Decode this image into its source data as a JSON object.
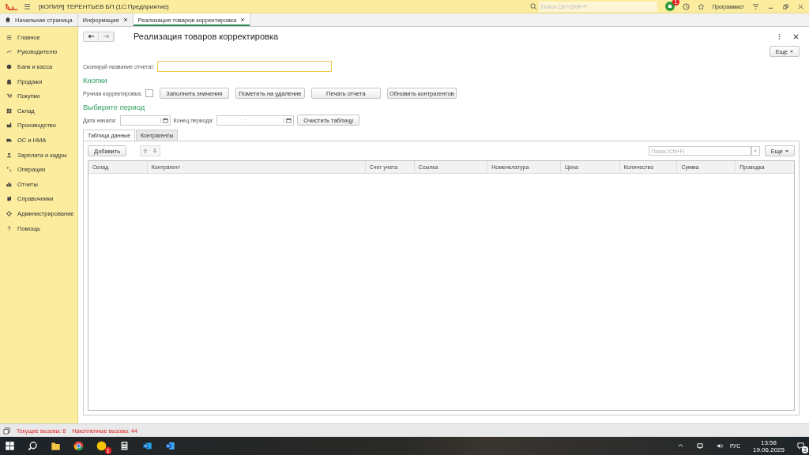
{
  "app": {
    "title": "[КОПИЯ] ТЕРЕНТЬЕВ БП  (1С:Предприятие)",
    "search_placeholder": "Поиск Ctrl+Shift+F",
    "notifications": "1",
    "user": "Программист"
  },
  "tabs": [
    {
      "kind": "home",
      "label": "Начальная страница",
      "selected": false
    },
    {
      "kind": "doc",
      "label": "Информация",
      "selected": false
    },
    {
      "kind": "doc",
      "label": "Реализация товаров корректировка",
      "selected": true
    }
  ],
  "sidebar": {
    "items": [
      "Главное",
      "Руководителю",
      "Банк и касса",
      "Продажи",
      "Покупки",
      "Склад",
      "Производство",
      "ОС и НМА",
      "Зарплата и кадры",
      "Операции",
      "Отчеты",
      "Справочники",
      "Администрирование",
      "Помощь"
    ]
  },
  "form": {
    "title": "Реализация товаров корректировка",
    "more": "Еще",
    "report_name": {
      "label": "Скопируй название отчета!:"
    },
    "buttons_heading": "Кнопки",
    "manual": {
      "label": "Ручная корректировка:",
      "checked": false
    },
    "buttons": [
      "Заполнить значения",
      "Пометить на удаление",
      "Печать отчета",
      "Обновить контрагентов"
    ],
    "period_heading": "Выбирите период",
    "start": {
      "label": "Дата начала:",
      "placeholder": " .  ."
    },
    "end": {
      "label": "Конец периода:",
      "placeholder": " .  .        :  :"
    },
    "clear": "Очистить таблицу",
    "inner_tabs": [
      {
        "label": "Таблица данные",
        "selected": true
      },
      {
        "label": "Контрагенты",
        "selected": false
      }
    ],
    "add": "Добавить",
    "search_placeholder": "Поиск (Ctrl+F)",
    "table_more": "Еще",
    "columns": [
      "Склад",
      "Контрагент",
      "Счет учета",
      "Ссылка",
      "Номенклатура",
      "Цена",
      "Количество",
      "Сумма",
      "Проводка"
    ]
  },
  "status_bar": {
    "current": "Текущие вызовы: 8",
    "accumulated": "Накопленные вызовы: 44"
  },
  "taskbar": {
    "app_badge": "1",
    "language": "РУС",
    "time": "13:58",
    "date": "19.06.2025",
    "notifications": "3"
  }
}
